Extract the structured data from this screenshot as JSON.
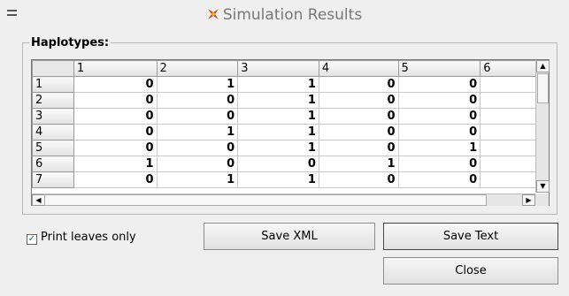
{
  "window": {
    "title": "Simulation Results",
    "menu_icon": "hamburger-menu-icon",
    "app_icon": "app-logo-icon"
  },
  "group": {
    "label": "Haplotypes:"
  },
  "table": {
    "columns": [
      "1",
      "2",
      "3",
      "4",
      "5",
      "6"
    ],
    "rows": [
      {
        "label": "1",
        "cells": [
          "0",
          "1",
          "1",
          "0",
          "0",
          ""
        ]
      },
      {
        "label": "2",
        "cells": [
          "0",
          "0",
          "1",
          "0",
          "0",
          ""
        ]
      },
      {
        "label": "3",
        "cells": [
          "0",
          "0",
          "1",
          "0",
          "0",
          ""
        ]
      },
      {
        "label": "4",
        "cells": [
          "0",
          "1",
          "1",
          "0",
          "0",
          ""
        ]
      },
      {
        "label": "5",
        "cells": [
          "0",
          "0",
          "1",
          "0",
          "1",
          ""
        ]
      },
      {
        "label": "6",
        "cells": [
          "1",
          "0",
          "0",
          "1",
          "0",
          ""
        ]
      },
      {
        "label": "7",
        "cells": [
          "0",
          "1",
          "1",
          "0",
          "0",
          ""
        ]
      }
    ]
  },
  "checkbox": {
    "label": "Print leaves only",
    "checked": true
  },
  "buttons": {
    "save_xml": "Save XML",
    "save_text": "Save Text",
    "close": "Close"
  },
  "colors": {
    "background": "#efefef",
    "title_text": "#777777",
    "check_mark": "#2a6ab0"
  }
}
